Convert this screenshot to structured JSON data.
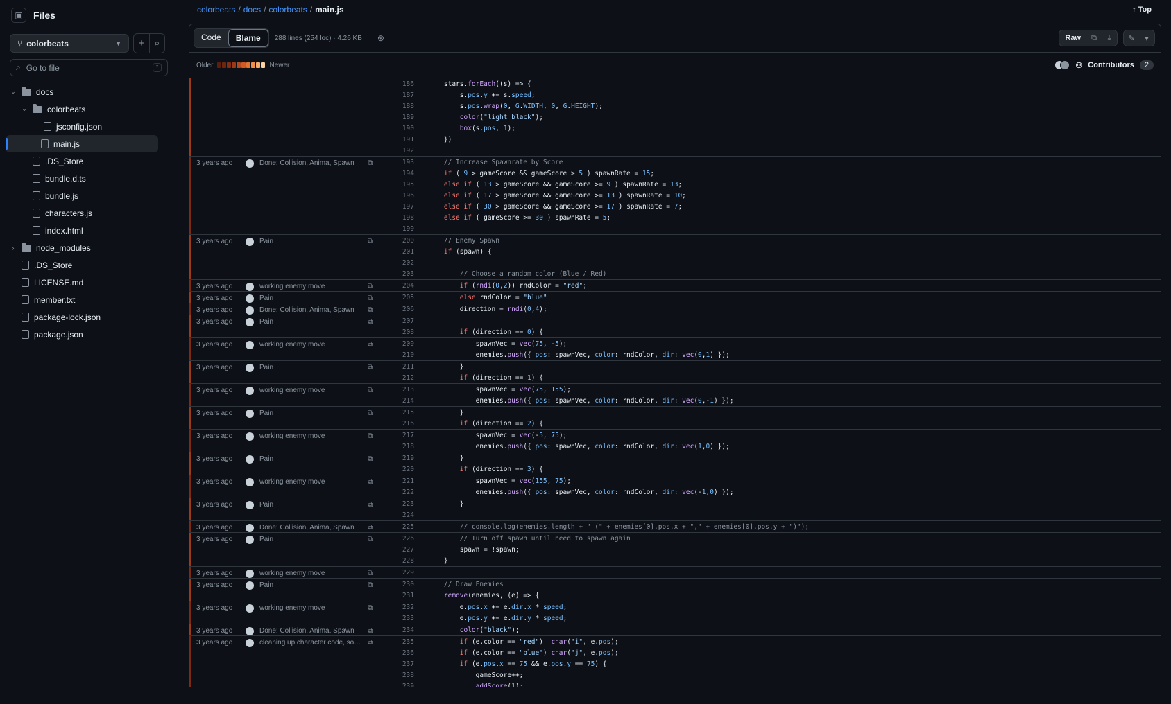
{
  "sidebar": {
    "title": "Files",
    "branch": "colorbeats",
    "search_placeholder": "Go to file",
    "search_kbd": "t",
    "tree": [
      {
        "label": "docs",
        "type": "folder",
        "depth": 0,
        "open": true
      },
      {
        "label": "colorbeats",
        "type": "folder",
        "depth": 1,
        "open": true
      },
      {
        "label": "jsconfig.json",
        "type": "file",
        "depth": 2
      },
      {
        "label": "main.js",
        "type": "file",
        "depth": 2,
        "active": true
      },
      {
        "label": ".DS_Store",
        "type": "file",
        "depth": 1
      },
      {
        "label": "bundle.d.ts",
        "type": "file",
        "depth": 1
      },
      {
        "label": "bundle.js",
        "type": "file",
        "depth": 1
      },
      {
        "label": "characters.js",
        "type": "file",
        "depth": 1
      },
      {
        "label": "index.html",
        "type": "file",
        "depth": 1
      },
      {
        "label": "node_modules",
        "type": "folder",
        "depth": 0,
        "open": false
      },
      {
        "label": ".DS_Store",
        "type": "file",
        "depth": 0
      },
      {
        "label": "LICENSE.md",
        "type": "file",
        "depth": 0
      },
      {
        "label": "member.txt",
        "type": "file",
        "depth": 0
      },
      {
        "label": "package-lock.json",
        "type": "file",
        "depth": 0
      },
      {
        "label": "package.json",
        "type": "file",
        "depth": 0
      }
    ]
  },
  "breadcrumb": {
    "parts": [
      "colorbeats",
      "docs",
      "colorbeats"
    ],
    "current": "main.js",
    "sep": "/",
    "top": "Top"
  },
  "toolbar": {
    "code": "Code",
    "blame": "Blame",
    "meta": "288 lines (254 loc) · 4.26 KB",
    "raw": "Raw"
  },
  "agebar": {
    "older": "Older",
    "newer": "Newer",
    "contributors": "Contributors",
    "count": "2"
  },
  "hunks": [
    {
      "age": "",
      "msg": "",
      "lines": [
        [
          186,
          "    stars.forEach((s) => {"
        ],
        [
          187,
          "        s.pos.y += s.speed;"
        ],
        [
          188,
          "        s.pos.wrap(0, G.WIDTH, 0, G.HEIGHT);"
        ],
        [
          189,
          "        color(\"light_black\");"
        ],
        [
          190,
          "        box(s.pos, 1);"
        ],
        [
          191,
          "    })"
        ],
        [
          192,
          ""
        ]
      ]
    },
    {
      "age": "3 years ago",
      "msg": "Done: Collision, Anima, Spawn",
      "lines": [
        [
          193,
          "    // Increase Spawnrate by Score"
        ],
        [
          194,
          "    if ( 9 > gameScore && gameScore > 5 ) spawnRate = 15;"
        ],
        [
          195,
          "    else if ( 13 > gameScore && gameScore >= 9 ) spawnRate = 13;"
        ],
        [
          196,
          "    else if ( 17 > gameScore && gameScore >= 13 ) spawnRate = 10;"
        ],
        [
          197,
          "    else if ( 30 > gameScore && gameScore >= 17 ) spawnRate = 7;"
        ],
        [
          198,
          "    else if ( gameScore >= 30 ) spawnRate = 5;"
        ],
        [
          199,
          ""
        ]
      ]
    },
    {
      "age": "3 years ago",
      "msg": "Pain",
      "lines": [
        [
          200,
          "    // Enemy Spawn"
        ],
        [
          201,
          "    if (spawn) {"
        ],
        [
          202,
          ""
        ],
        [
          203,
          "        // Choose a random color (Blue / Red)"
        ]
      ]
    },
    {
      "age": "3 years ago",
      "msg": "working enemy move",
      "lines": [
        [
          204,
          "        if (rndi(0,2)) rndColor = \"red\";"
        ]
      ]
    },
    {
      "age": "3 years ago",
      "msg": "Pain",
      "lines": [
        [
          205,
          "        else rndColor = \"blue\""
        ]
      ]
    },
    {
      "age": "3 years ago",
      "msg": "Done: Collision, Anima, Spawn",
      "lines": [
        [
          206,
          "        direction = rndi(0,4);"
        ]
      ]
    },
    {
      "age": "3 years ago",
      "msg": "Pain",
      "lines": [
        [
          207,
          ""
        ],
        [
          208,
          "        if (direction == 0) {"
        ]
      ]
    },
    {
      "age": "3 years ago",
      "msg": "working enemy move",
      "lines": [
        [
          209,
          "            spawnVec = vec(75, -5);"
        ],
        [
          210,
          "            enemies.push({ pos: spawnVec, color: rndColor, dir: vec(0,1) });"
        ]
      ]
    },
    {
      "age": "3 years ago",
      "msg": "Pain",
      "lines": [
        [
          211,
          "        }"
        ],
        [
          212,
          "        if (direction == 1) {"
        ]
      ]
    },
    {
      "age": "3 years ago",
      "msg": "working enemy move",
      "lines": [
        [
          213,
          "            spawnVec = vec(75, 155);"
        ],
        [
          214,
          "            enemies.push({ pos: spawnVec, color: rndColor, dir: vec(0,-1) });"
        ]
      ]
    },
    {
      "age": "3 years ago",
      "msg": "Pain",
      "lines": [
        [
          215,
          "        }"
        ],
        [
          216,
          "        if (direction == 2) {"
        ]
      ]
    },
    {
      "age": "3 years ago",
      "msg": "working enemy move",
      "lines": [
        [
          217,
          "            spawnVec = vec(-5, 75);"
        ],
        [
          218,
          "            enemies.push({ pos: spawnVec, color: rndColor, dir: vec(1,0) });"
        ]
      ]
    },
    {
      "age": "3 years ago",
      "msg": "Pain",
      "lines": [
        [
          219,
          "        }"
        ],
        [
          220,
          "        if (direction == 3) {"
        ]
      ]
    },
    {
      "age": "3 years ago",
      "msg": "working enemy move",
      "lines": [
        [
          221,
          "            spawnVec = vec(155, 75);"
        ],
        [
          222,
          "            enemies.push({ pos: spawnVec, color: rndColor, dir: vec(-1,0) });"
        ]
      ]
    },
    {
      "age": "3 years ago",
      "msg": "Pain",
      "lines": [
        [
          223,
          "        }"
        ],
        [
          224,
          ""
        ]
      ]
    },
    {
      "age": "3 years ago",
      "msg": "Done: Collision, Anima, Spawn",
      "lines": [
        [
          225,
          "        // console.log(enemies.length + \" (\" + enemies[0].pos.x + \",\" + enemies[0].pos.y + \")\");"
        ]
      ]
    },
    {
      "age": "3 years ago",
      "msg": "Pain",
      "lines": [
        [
          226,
          "        // Turn off spawn until need to spawn again"
        ],
        [
          227,
          "        spawn = !spawn;"
        ],
        [
          228,
          "    }"
        ]
      ]
    },
    {
      "age": "3 years ago",
      "msg": "working enemy move",
      "lines": [
        [
          229,
          ""
        ]
      ]
    },
    {
      "age": "3 years ago",
      "msg": "Pain",
      "lines": [
        [
          230,
          "    // Draw Enemies"
        ],
        [
          231,
          "    remove(enemies, (e) => {"
        ]
      ]
    },
    {
      "age": "3 years ago",
      "msg": "working enemy move",
      "lines": [
        [
          232,
          "        e.pos.x += e.dir.x * speed;"
        ],
        [
          233,
          "        e.pos.y += e.dir.y * speed;"
        ]
      ]
    },
    {
      "age": "3 years ago",
      "msg": "Done: Collision, Anima, Spawn",
      "lines": [
        [
          234,
          "        color(\"black\");"
        ]
      ]
    },
    {
      "age": "3 years ago",
      "msg": "cleaning up character code, sou…",
      "lines": [
        [
          235,
          "        if (e.color == \"red\")  char(\"i\", e.pos);"
        ],
        [
          236,
          "        if (e.color == \"blue\") char(\"j\", e.pos);"
        ],
        [
          237,
          "        if (e.pos.x == 75 && e.pos.y == 75) {"
        ],
        [
          238,
          "            gameScore++;"
        ],
        [
          239,
          "            addScore(1);"
        ]
      ]
    }
  ]
}
